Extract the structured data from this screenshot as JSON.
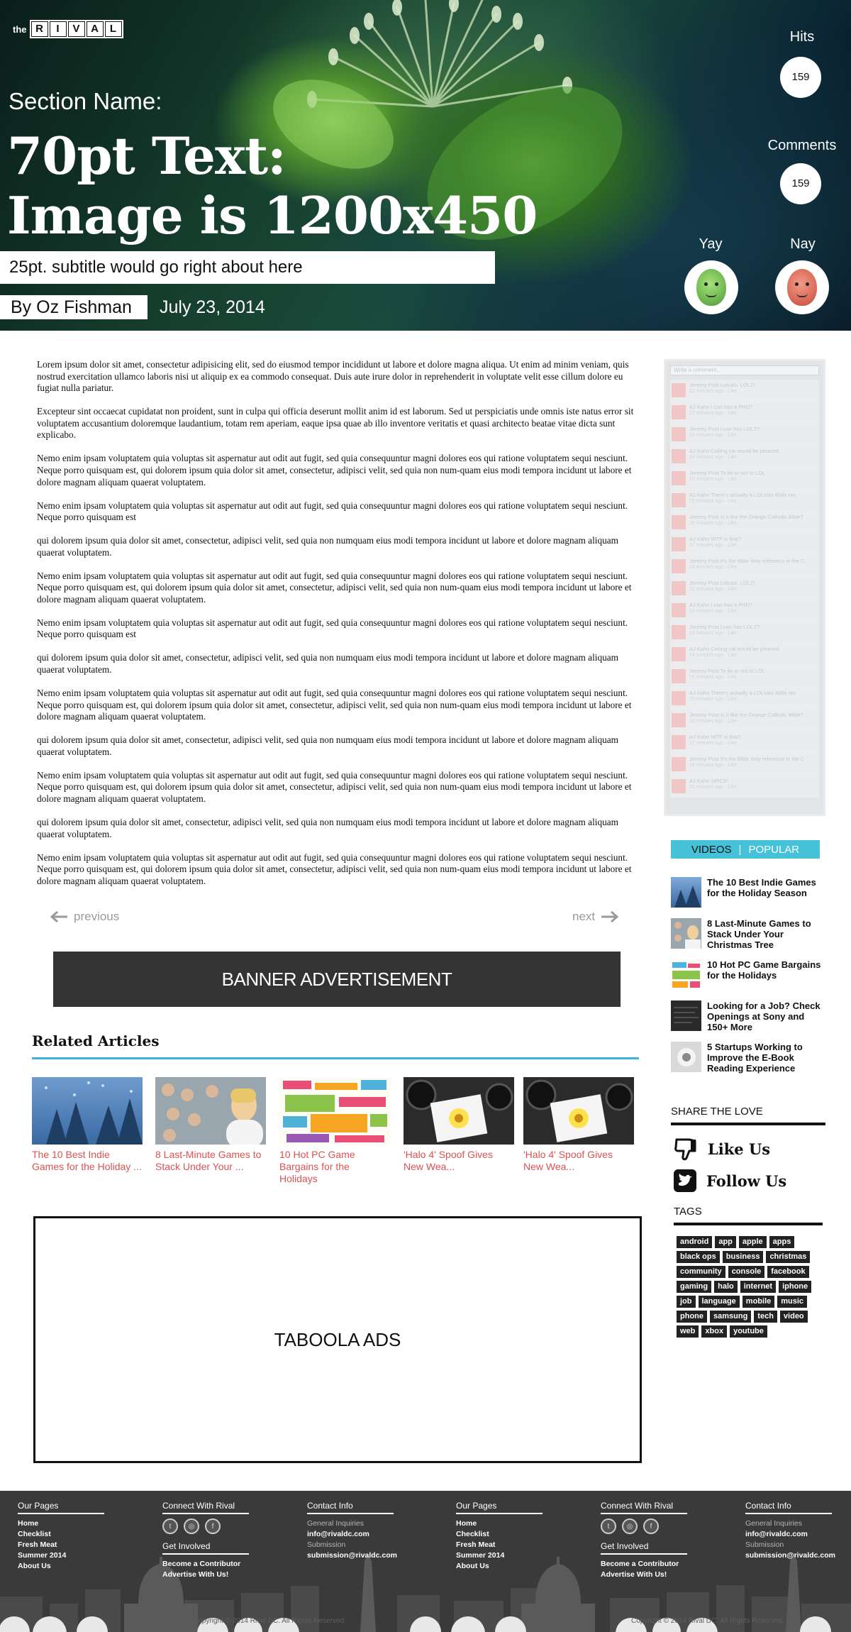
{
  "logo": {
    "prefix": "the",
    "letters": [
      "R",
      "I",
      "V",
      "A",
      "L"
    ]
  },
  "hero": {
    "section_name": "Section Name:",
    "headline_line1": "70pt Text:",
    "headline_line2": "Image is 1200x450",
    "subtitle": "25pt. subtitle would go right about here",
    "byline": "By Oz Fishman",
    "date": "July 23, 2014"
  },
  "stats": {
    "hits_label": "Hits",
    "hits_value": "159",
    "comments_label": "Comments",
    "comments_value": "159",
    "yay_label": "Yay",
    "nay_label": "Nay"
  },
  "article": {
    "paragraphs": [
      "Lorem ipsum dolor sit amet, consectetur adipisicing elit, sed do eiusmod tempor incididunt ut labore et dolore magna aliqua. Ut enim ad minim veniam, quis nostrud exercitation ullamco laboris nisi ut aliquip ex ea commodo consequat. Duis aute irure dolor in reprehenderit in voluptate velit esse cillum dolore eu fugiat nulla pariatur.",
      "Excepteur sint occaecat cupidatat non proident, sunt in culpa qui officia deserunt mollit anim id est laborum. Sed ut perspiciatis unde omnis iste natus error sit voluptatem accusantium doloremque laudantium, totam rem aperiam, eaque ipsa quae ab illo inventore veritatis et quasi architecto beatae vitae dicta sunt explicabo.",
      "Nemo enim ipsam voluptatem quia voluptas sit aspernatur aut odit aut fugit, sed quia consequuntur magni dolores eos qui ratione voluptatem sequi nesciunt. Neque porro quisquam est, qui dolorem ipsum quia dolor sit amet, consectetur, adipisci velit, sed quia non num-quam eius modi tempora incidunt ut labore et dolore magnam aliquam quaerat voluptatem.",
      "Nemo enim ipsam voluptatem quia voluptas sit aspernatur aut odit aut fugit, sed quia consequuntur magni dolores eos qui ratione voluptatem sequi nesciunt. Neque porro quisquam est",
      "qui dolorem ipsum quia dolor sit amet, consectetur, adipisci velit, sed quia non numquam eius modi tempora incidunt ut labore et dolore magnam aliquam quaerat voluptatem.",
      "Nemo enim ipsam voluptatem quia voluptas sit aspernatur aut odit aut fugit, sed quia consequuntur magni dolores eos qui ratione voluptatem sequi nesciunt. Neque porro quisquam est, qui dolorem ipsum quia dolor sit amet, consectetur, adipisci velit, sed quia non num-quam eius modi tempora incidunt ut labore et dolore magnam aliquam quaerat voluptatem.",
      "Nemo enim ipsam voluptatem quia voluptas sit aspernatur aut odit aut fugit, sed quia consequuntur magni dolores eos qui ratione voluptatem sequi nesciunt. Neque porro quisquam est",
      "qui dolorem ipsum quia dolor sit amet, consectetur, adipisci velit, sed quia non numquam eius modi tempora incidunt ut labore et dolore magnam aliquam quaerat voluptatem.",
      "Nemo enim ipsam voluptatem quia voluptas sit aspernatur aut odit aut fugit, sed quia consequuntur magni dolores eos qui ratione voluptatem sequi nesciunt. Neque porro quisquam est, qui dolorem ipsum quia dolor sit amet, consectetur, adipisci velit, sed quia non num-quam eius modi tempora incidunt ut labore et dolore magnam aliquam quaerat voluptatem.",
      "qui dolorem ipsum quia dolor sit amet, consectetur, adipisci velit, sed quia non numquam eius modi tempora incidunt ut labore et dolore magnam aliquam quaerat voluptatem.",
      "Nemo enim ipsam voluptatem quia voluptas sit aspernatur aut odit aut fugit, sed quia consequuntur magni dolores eos qui ratione voluptatem sequi nesciunt. Neque porro quisquam est, qui dolorem ipsum quia dolor sit amet, consectetur, adipisci velit, sed quia non num-quam eius modi tempora incidunt ut labore et dolore magnam aliquam quaerat voluptatem.",
      "qui dolorem ipsum quia dolor sit amet, consectetur, adipisci velit, sed quia non numquam eius modi tempora incidunt ut labore et dolore magnam aliquam quaerat voluptatem.",
      "Nemo enim ipsam voluptatem quia voluptas sit aspernatur aut odit aut fugit, sed quia consequuntur magni dolores eos qui ratione voluptatem sequi nesciunt. Neque porro quisquam est, qui dolorem ipsum quia dolor sit amet, consectetur, adipisci velit, sed quia non num-quam eius modi tempora incidunt ut labore et dolore magnam aliquam quaerat voluptatem."
    ]
  },
  "pager": {
    "previous": "previous",
    "next": "next"
  },
  "banner": "BANNER ADVERTISEMENT",
  "related": {
    "title": "Related Articles",
    "items": [
      "The 10 Best Indie Games for the Holiday ...",
      "8 Last-Minute Games to Stack Under Your ...",
      "10 Hot PC Game Bargains for the Holidays",
      "'Halo 4' Spoof Gives New Wea...",
      "'Halo 4' Spoof Gives New Wea..."
    ]
  },
  "taboola": "TABOOLA ADS",
  "comments_widget": {
    "placeholder": "Write a comment...",
    "items": [
      {
        "text": "Jeremy Post Lolcats. LOLZ!",
        "meta": "12 minutes ago · Like"
      },
      {
        "text": "AJ Kahn I can has a PHD?",
        "meta": "13 minutes ago · Like"
      },
      {
        "text": "Jeremy Post I can has LOLZ?",
        "meta": "13 minutes ago · Like"
      },
      {
        "text": "AJ Kahn Ceiling cat would be pleased.",
        "meta": "14 minutes ago · Like"
      },
      {
        "text": "Jeremy Post To lie or not to LOL",
        "meta": "15 minutes ago · Like"
      },
      {
        "text": "AJ Kahn There's actually a LOLcats Bible rev",
        "meta": "15 minutes ago · Like"
      },
      {
        "text": "Jeremy Post Is it like the Orange Catholic Bible?",
        "meta": "16 minutes ago · Like"
      },
      {
        "text": "AJ Kahn WTF is that?",
        "meta": "17 minutes ago · Like"
      },
      {
        "text": "Jeremy Post It's the Bible they reference in the C",
        "meta": "18 minutes ago · Like"
      },
      {
        "text": "Jeremy Post Lolcats. LOLZ!",
        "meta": "12 minutes ago · Like"
      },
      {
        "text": "AJ Kahn I can has a PHD?",
        "meta": "13 minutes ago · Like"
      },
      {
        "text": "Jeremy Post I can has LOLZ?",
        "meta": "13 minutes ago · Like"
      },
      {
        "text": "AJ Kahn Ceiling cat would be pleased.",
        "meta": "14 minutes ago · Like"
      },
      {
        "text": "Jeremy Post To lie or not to LOL",
        "meta": "15 minutes ago · Like"
      },
      {
        "text": "AJ Kahn There's actually a LOLcats Bible rev",
        "meta": "15 minutes ago · Like"
      },
      {
        "text": "Jeremy Post Is it like the Orange Catholic Bible?",
        "meta": "16 minutes ago · Like"
      },
      {
        "text": "AJ Kahn WTF is that?",
        "meta": "17 minutes ago · Like"
      },
      {
        "text": "Jeremy Post It's the Bible they reference in the C",
        "meta": "18 minutes ago · Like"
      },
      {
        "text": "AJ Kahn SPICE!",
        "meta": "20 minutes ago · Like"
      }
    ]
  },
  "sidebar_tabs": {
    "videos": "VIDEOS",
    "separator": "|",
    "popular": "POPULAR"
  },
  "sidebar_items": [
    "The 10 Best Indie Games for the Holiday Season",
    "8 Last-Minute Games to Stack Under Your Christmas Tree",
    "10 Hot PC Game Bargains for the Holidays",
    "Looking for a Job? Check Openings at Sony and 150+ More",
    "5 Startups Working to Improve the E-Book Reading Experience"
  ],
  "share": {
    "heading": "SHARE THE LOVE",
    "like": "Like Us",
    "follow": "Follow Us"
  },
  "tags": {
    "heading": "TAGS",
    "items": [
      "android",
      "app",
      "apple",
      "apps",
      "black ops",
      "business",
      "christmas",
      "community",
      "console",
      "facebook",
      "gaming",
      "halo",
      "internet",
      "iphone",
      "job",
      "language",
      "mobile",
      "music",
      "phone",
      "samsung",
      "tech",
      "video",
      "web",
      "xbox",
      "youtube"
    ]
  },
  "footer": {
    "our_pages": {
      "heading": "Our Pages",
      "links": [
        "Home",
        "Checklist",
        "Fresh Meat",
        "Summer 2014",
        "About Us"
      ]
    },
    "connect": {
      "heading": "Connect With Rival",
      "involved_heading": "Get Involved",
      "involved_links": [
        "Become a Contributor",
        "Advertise With Us!"
      ]
    },
    "contact": {
      "heading": "Contact Info",
      "general_label": "General Inquiries",
      "general_email": "info@rivaldc.com",
      "submission_label": "Submission",
      "submission_email": "submission@rivaldc.com"
    },
    "copyright": "Copyright © 2014 Rival DC. All Rights Reserved."
  },
  "colors": {
    "accent": "#45c1d8",
    "related_link": "#d9534f",
    "banner_bg": "#333333",
    "footer_bg": "#3a3a3a"
  }
}
